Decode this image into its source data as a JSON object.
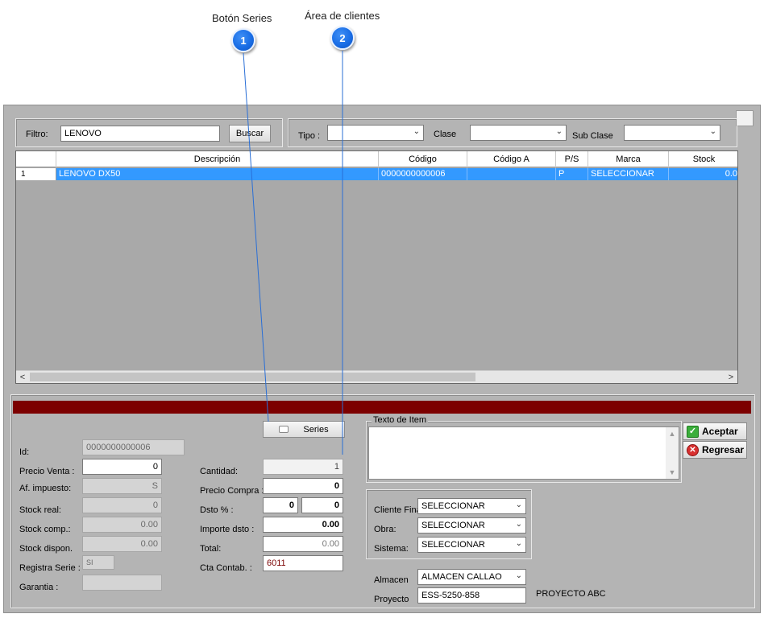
{
  "callouts": [
    {
      "title": "Botón Series",
      "number": "1"
    },
    {
      "title": "Área de clientes",
      "number": "2"
    }
  ],
  "filter": {
    "label": "Filtro:",
    "value": "LENOVO",
    "search_button": "Buscar"
  },
  "selectors": {
    "tipo_label": "Tipo :",
    "clase_label": "Clase",
    "subclase_label": "Sub Clase"
  },
  "grid": {
    "columns": [
      "Descripción",
      "Código",
      "Código A",
      "P/S",
      "Marca",
      "Stock"
    ],
    "rows": [
      {
        "index": "1",
        "descripcion": "LENOVO DX50",
        "codigo": "0000000000006",
        "codigo_a": "",
        "ps": "P",
        "marca": "SELECCIONAR",
        "stock": "0.0"
      }
    ]
  },
  "series_button": "Series",
  "fields": {
    "id": {
      "label": "Id:",
      "value": "0000000000006"
    },
    "precio_venta": {
      "label": "Precio Venta :",
      "value": "0"
    },
    "af_impuesto": {
      "label": "Af. impuesto:",
      "value": "S"
    },
    "stock_real": {
      "label": "Stock real:",
      "value": "0"
    },
    "stock_comp": {
      "label": "Stock comp.:",
      "value": "0.00"
    },
    "stock_dispon": {
      "label": "Stock dispon.",
      "value": "0.00"
    },
    "registra_serie": {
      "label": "Registra Serie :",
      "value": "SI"
    },
    "garantia": {
      "label": "Garantia :",
      "value": ""
    },
    "cantidad": {
      "label": "Cantidad:",
      "value": "1"
    },
    "precio_compra": {
      "label": "Precio Compra :",
      "value": "0"
    },
    "dsto": {
      "label": "Dsto % :",
      "value1": "0",
      "value2": "0"
    },
    "importe_dsto": {
      "label": "Importe dsto :",
      "value": "0.00"
    },
    "total": {
      "label": "Total:",
      "value": "0.00"
    },
    "cta_contab": {
      "label": "Cta Contab. :",
      "value": "6011"
    }
  },
  "texto_item": {
    "label": "Texto de Item",
    "value": ""
  },
  "actions": {
    "accept": "Aceptar",
    "back": "Regresar"
  },
  "client": {
    "cliente_final": {
      "label": "Cliente Final",
      "value": "SELECCIONAR"
    },
    "obra": {
      "label": "Obra:",
      "value": "SELECCIONAR"
    },
    "sistema": {
      "label": "Sistema:",
      "value": "SELECCIONAR"
    }
  },
  "almacen": {
    "label": "Almacen",
    "value": "ALMACEN CALLAO"
  },
  "proyecto": {
    "label": "Proyecto",
    "value": "ESS-5250-858",
    "name": "PROYECTO ABC"
  },
  "colors": {
    "selection": "#3399ff",
    "dark_bar": "#7c0000",
    "callout": "#1a6ee6",
    "callout_line": "#2a6fd6"
  }
}
